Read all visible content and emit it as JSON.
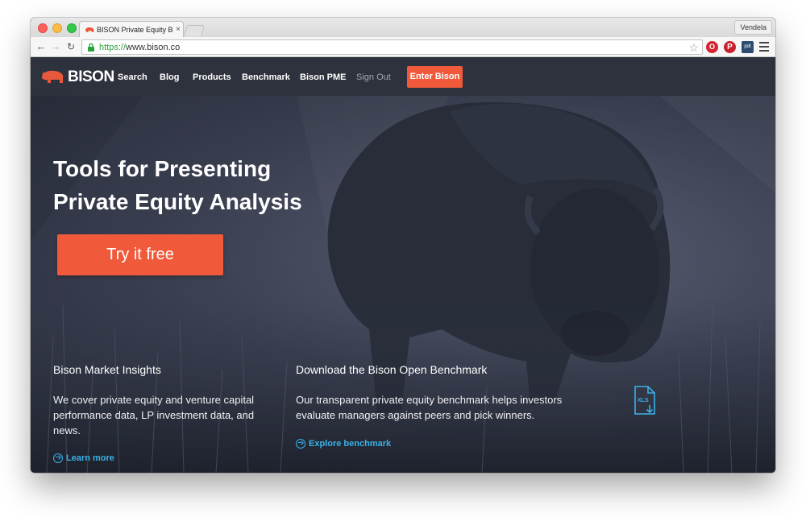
{
  "browser": {
    "tab_title": "BISON Private Equity Bench",
    "tab_close": "×",
    "profile_name": "Vendela",
    "url_scheme": "https://",
    "url_host": "www.bison.co",
    "ext_opera": "O",
    "ext_pinterest": "P",
    "ext_pdt": "pdt",
    "icons": [
      "back-icon",
      "forward-icon",
      "reload-icon",
      "lock-icon",
      "star-icon",
      "menu-icon"
    ]
  },
  "header": {
    "logo_text": "BISON",
    "nav": [
      "Search",
      "Blog",
      "Products",
      "Benchmark",
      "Bison PME",
      "Sign Out"
    ],
    "enter_button": "Enter Bison"
  },
  "hero": {
    "title_line1": "Tools for Presenting",
    "title_line2": "Private Equity Analysis",
    "cta": "Try it free"
  },
  "columns": {
    "insights": {
      "title": "Bison Market Insights",
      "text": "We cover private equity and venture capital performance data, LP investment data, and news.",
      "link": "Learn more"
    },
    "benchmark": {
      "title": "Download the Bison Open Benchmark",
      "text": "Our transparent private equity benchmark helps investors evaluate managers against peers and pick winners.",
      "link": "Explore benchmark",
      "file_label": "XLS"
    }
  },
  "colors": {
    "accent": "#f05a3a",
    "link": "#3ab1e8",
    "header_bg": "#2e323c",
    "url_green": "#2aa33a"
  }
}
